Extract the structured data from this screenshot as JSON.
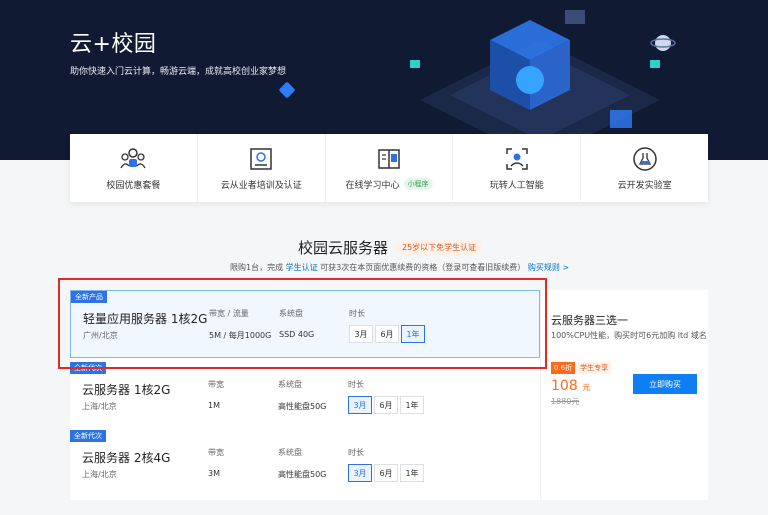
{
  "hero": {
    "title": "云+校园",
    "subtitle": "助你快速入门云计算，畅游云端，成就高校创业家梦想"
  },
  "categories": [
    {
      "label": "校园优惠套餐",
      "icon": "people-group-icon"
    },
    {
      "label": "云从业者培训及认证",
      "icon": "certificate-icon"
    },
    {
      "label": "在线学习中心",
      "badge": "小程序",
      "icon": "book-icon"
    },
    {
      "label": "玩转人工智能",
      "icon": "ai-scan-icon"
    },
    {
      "label": "云开发实验室",
      "icon": "flask-icon"
    }
  ],
  "section": {
    "title": "校园云服务器",
    "tag": "25岁以下免学生认证",
    "note_a": "限购1台，完成 ",
    "note_link": "学生认证",
    "note_b": " 可获3次在本页面优惠续费的资格（登录可查看旧版续费）",
    "note_rule": "购买规则 >"
  },
  "products": [
    {
      "tag": "全新产品",
      "name": "轻量应用服务器 1核2G",
      "region": "广州/北京",
      "bw_label": "带宽 / 流量",
      "bw_value": "5M / 每月1000G",
      "disk_label": "系统盘",
      "disk_value": "SSD 40G",
      "dur_label": "时长",
      "durations": [
        "3月",
        "6月",
        "1年"
      ],
      "selected": 2
    },
    {
      "tag": "全新代次",
      "name": "云服务器 1核2G",
      "region": "上海/北京",
      "bw_label": "带宽",
      "bw_value": "1M",
      "disk_label": "系统盘",
      "disk_value": "高性能盘50G",
      "dur_label": "时长",
      "durations": [
        "3月",
        "6月",
        "1年"
      ],
      "selected": 0
    },
    {
      "tag": "全新代次",
      "name": "云服务器 2核4G",
      "region": "上海/北京",
      "bw_label": "带宽",
      "bw_value": "3M",
      "disk_label": "系统盘",
      "disk_value": "高性能盘50G",
      "dur_label": "时长",
      "durations": [
        "3月",
        "6月",
        "1年"
      ],
      "selected": 0
    }
  ],
  "side": {
    "title": "云服务器三选一",
    "desc": "100%CPU性能，购买时可6元加购 ltd 域名",
    "discount": "0.6折",
    "student": "学生专享",
    "price": "108",
    "unit": "元",
    "orig": "1880元",
    "buy": "立即购买"
  },
  "colors": {
    "accent": "#2d73e6",
    "price": "#ff6a1a",
    "hero_bg": "#111a33"
  }
}
